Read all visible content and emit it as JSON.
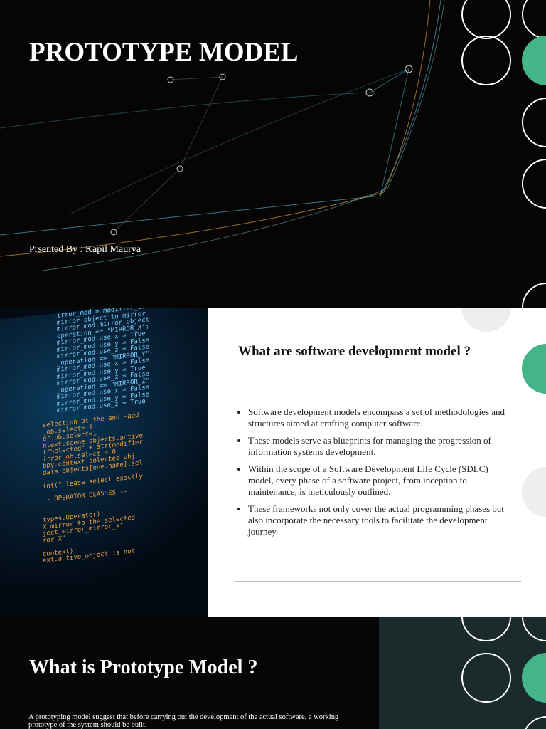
{
  "slide1": {
    "title": "PROTOTYPE MODEL",
    "presenter": "Prsented By : Kapil Maurya"
  },
  "slide2": {
    "heading": "What are software development model ?",
    "bullets": [
      "Software development models encompass a set of methodologies and structures aimed at crafting computer software.",
      "These models serve as blueprints for managing the progression of information systems development.",
      "Within the scope of a Software Development Life Cycle (SDLC) model, every phase of a software project, from inception to maintenance, is meticulously outlined.",
      "These frameworks not only cover the actual programming phases but also incorporate the necessary tools to facilitate the development journey."
    ],
    "code_lines": [
      "irror_mod = modifier_ob",
      "mirror object to mirror",
      "mirror_mod.mirror_object",
      "operation == \"MIRROR_X\":",
      "mirror_mod.use_x = True",
      "mirror_mod.use_y = False",
      "mirror_mod.use_z = False",
      "_operation == \"MIRROR_Y\":",
      "mirror_mod.use_x = False",
      "mirror_mod.use_y = True",
      "mirror_mod.use_z = False",
      "_operation == \"MIRROR_Z\":",
      "mirror_mod.use_x = False",
      "mirror_mod.use_y = False",
      "mirror_mod.use_z = True",
      "",
      "selection at the end -add",
      "_ob.select= 1",
      "er_ob.select=1",
      "ntext.scene.objects.active",
      "(\"Selected\" + str(modifier",
      "irror_ob.select = 0",
      "bpy.context.selected_obj",
      "data.objects[one.name].sel",
      "",
      "int(\"please select exactly",
      "",
      "-- OPERATOR CLASSES ----",
      "",
      "",
      "types.Operator):",
      "X mirror to the selected",
      "ject.mirror_mirror_x\"",
      "ror X\"",
      "",
      "context):",
      "ext.active_object is not"
    ]
  },
  "slide3": {
    "heading": "What is Prototype Model ?",
    "body": "A prototyping model suggest that before carrying out the development of the actual software, a working prototype of the  system should be built."
  },
  "colors": {
    "accent": "#44b58a",
    "panel": "#1b2a2a"
  }
}
